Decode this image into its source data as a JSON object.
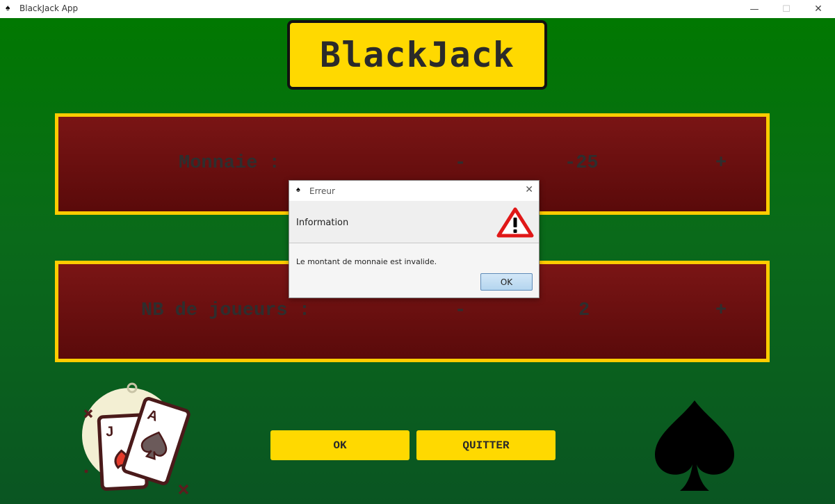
{
  "window": {
    "title": "BlackJack App",
    "icon": "spade-icon",
    "minimize": "—",
    "maximize": "☐",
    "close": "✕"
  },
  "game": {
    "logo": "BlackJack",
    "money": {
      "label": "Monnaie :",
      "minus": "-",
      "value": "-25",
      "plus": "+"
    },
    "players": {
      "label": "NB de joueurs :",
      "minus": "-",
      "value": "2",
      "plus": "+"
    },
    "buttons": {
      "ok": "OK",
      "quit": "QUITTER"
    },
    "colors": {
      "background": "#017801",
      "accent": "#ffd900",
      "panel": "#6b1010",
      "panel_border": "#ffcc00"
    }
  },
  "dialog": {
    "title": "Erreur",
    "close": "✕",
    "header": "Information",
    "message": "Le montant de monnaie est invalide.",
    "ok": "OK",
    "icon": "warning-icon"
  }
}
